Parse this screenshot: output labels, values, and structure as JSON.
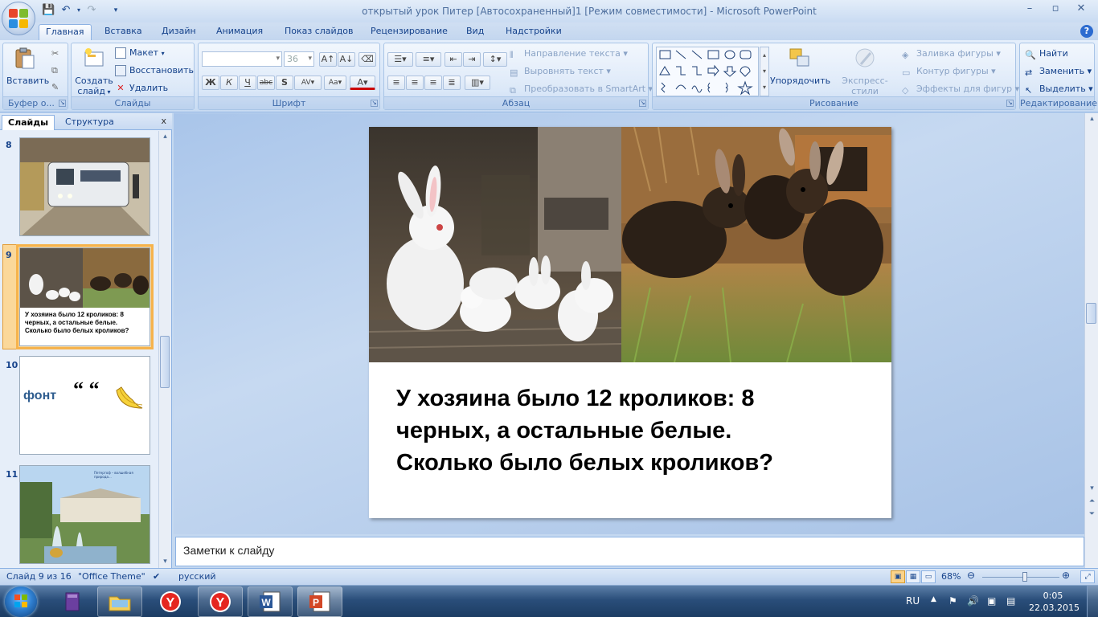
{
  "window": {
    "title": "открытый урок Питер [Автосохраненный]1 [Режим совместимости] - Microsoft PowerPoint"
  },
  "ribbon_tabs": [
    "Главная",
    "Вставка",
    "Дизайн",
    "Анимация",
    "Показ слайдов",
    "Рецензирование",
    "Вид",
    "Надстройки"
  ],
  "groups": {
    "clipboard": {
      "label": "Буфер о...",
      "paste": "Вставить"
    },
    "slides": {
      "label": "Слайды",
      "new_slide_1": "Создать",
      "new_slide_2": "слайд",
      "layout": "Макет",
      "reset": "Восстановить",
      "delete": "Удалить"
    },
    "font": {
      "label": "Шрифт",
      "font_name": "",
      "font_size": "36"
    },
    "paragraph": {
      "label": "Абзац",
      "text_direction": "Направление текста",
      "align_text": "Выровнять текст",
      "smartart": "Преобразовать в SmartArt"
    },
    "drawing": {
      "label": "Рисование",
      "arrange": "Упорядочить",
      "quick_styles": "Экспресс-стили",
      "shape_fill": "Заливка фигуры",
      "shape_outline": "Контур фигуры",
      "shape_effects": "Эффекты для фигур"
    },
    "editing": {
      "label": "Редактирование",
      "find": "Найти",
      "replace": "Заменить",
      "select": "Выделить"
    }
  },
  "panel": {
    "tab_slides": "Слайды",
    "tab_outline": "Структура",
    "thumbnails": [
      {
        "num": "8"
      },
      {
        "num": "9",
        "text": "У хозяина было  12 кроликов: 8 черных, а остальные белые. Сколько было белых кроликов?"
      },
      {
        "num": "10",
        "word": "фонт",
        "quote": "“ “"
      },
      {
        "num": "11",
        "caption": "Петергоф – волшебная природа..."
      }
    ]
  },
  "slide": {
    "text_line1": "У хозяина было  12 кроликов: 8",
    "text_line2": "черных, а остальные белые.",
    "text_line3": "Сколько было белых кроликов?"
  },
  "notes": {
    "placeholder": "Заметки к слайду"
  },
  "status": {
    "slide_of": "Слайд 9 из 16",
    "theme": "\"Office Theme\"",
    "language": "русский",
    "zoom": "68%",
    "zoom_fraction": 0.55
  },
  "taskbar": {
    "lang": "RU",
    "time": "0:05",
    "date": "22.03.2015"
  },
  "colors": {
    "ribbon_text": "#15428b",
    "selection": "#f6b34c",
    "taskbar": "#2a4e7a"
  }
}
